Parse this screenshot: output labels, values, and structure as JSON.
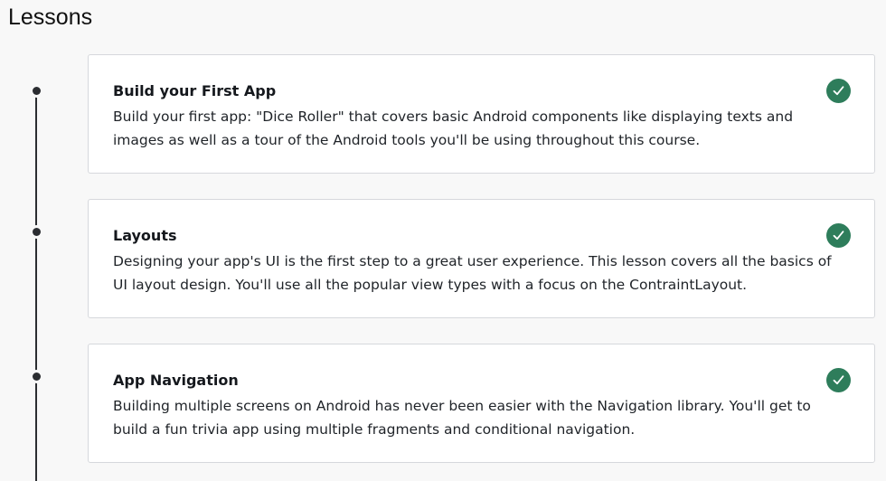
{
  "page": {
    "title": "Lessons"
  },
  "colors": {
    "accent_complete": "#2e7d5b",
    "timeline": "#2b2d31",
    "card_border": "#d6d8dc"
  },
  "lessons": [
    {
      "title": "Build your First App",
      "description": "Build your first app: \"Dice Roller\" that covers basic Android components like displaying texts and images as well as a tour of the Android tools you'll be using throughout this course.",
      "status_icon": "check-circle-icon",
      "completed": true
    },
    {
      "title": "Layouts",
      "description": "Designing your app's UI is the first step to a great user experience. This lesson covers all the basics of UI layout design. You'll use all the popular view types with a focus on the ContraintLayout.",
      "status_icon": "check-circle-icon",
      "completed": true
    },
    {
      "title": "App Navigation",
      "description": "Building multiple screens on Android has never been easier with the Navigation library. You'll get to build a fun trivia app using multiple fragments and conditional navigation.",
      "status_icon": "check-circle-icon",
      "completed": true
    }
  ]
}
